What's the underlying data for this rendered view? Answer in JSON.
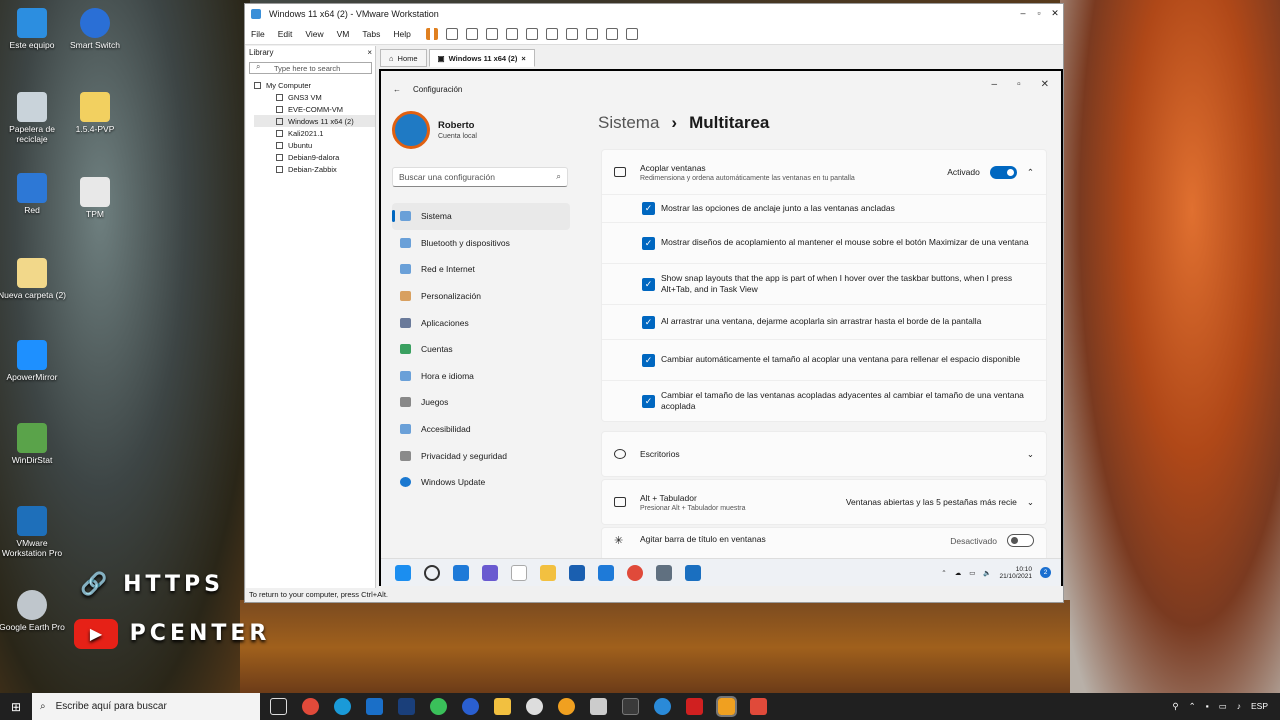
{
  "desktop": {
    "icons": [
      {
        "label": "Este equipo"
      },
      {
        "label": "Smart Switch"
      },
      {
        "label": "Papelera de reciclaje"
      },
      {
        "label": "1.5.4-PVP"
      },
      {
        "label": "Red"
      },
      {
        "label": "TPM"
      },
      {
        "label": "Nueva carpeta (2)"
      },
      {
        "label": "ApowerMirror"
      },
      {
        "label": "WinDirStat"
      },
      {
        "label": "VMware Workstation Pro"
      },
      {
        "label": "Google Earth Pro"
      }
    ],
    "overlay_line1": "HTTPS",
    "overlay_line2": "PCENTER"
  },
  "vmware": {
    "title": "Windows 11 x64 (2) - VMware Workstation",
    "menu": [
      "File",
      "Edit",
      "View",
      "VM",
      "Tabs",
      "Help"
    ],
    "library": {
      "header": "Library",
      "close": "×",
      "search_placeholder": "Type here to search",
      "root": "My Computer",
      "vms": [
        "GNS3 VM",
        "EVE-COMM-VM",
        "Windows 11 x64 (2)",
        "Kali2021.1",
        "Ubuntu",
        "Debian9-dalora",
        "Debian-Zabbix"
      ]
    },
    "tabs": [
      {
        "label": "Home"
      },
      {
        "label": "Windows 11 x64 (2)"
      }
    ],
    "status": "To return to your computer, press Ctrl+Alt."
  },
  "settings": {
    "app_title": "Configuración",
    "user": {
      "name": "Roberto",
      "account": "Cuenta local"
    },
    "search_placeholder": "Buscar una configuración",
    "nav": [
      "Sistema",
      "Bluetooth y dispositivos",
      "Red e Internet",
      "Personalización",
      "Aplicaciones",
      "Cuentas",
      "Hora e idioma",
      "Juegos",
      "Accesibilidad",
      "Privacidad y seguridad",
      "Windows Update"
    ],
    "breadcrumb": {
      "parent": "Sistema",
      "sep": "›",
      "current": "Multitarea"
    },
    "snap": {
      "title": "Acoplar ventanas",
      "subtitle": "Redimensiona y ordena automáticamente las ventanas en tu pantalla",
      "state": "Activado",
      "options": [
        "Mostrar las opciones de anclaje junto a las ventanas ancladas",
        "Mostrar diseños de acoplamiento al mantener el mouse sobre el botón Maximizar de una ventana",
        "Show snap layouts that the app is part of when I hover over the taskbar buttons, when I press Alt+Tab, and in Task View",
        "Al arrastrar una ventana, dejarme acoplarla sin arrastrar hasta el borde de la pantalla",
        "Cambiar automáticamente el tamaño al acoplar una ventana para rellenar el espacio disponible",
        "Cambiar el tamaño de las ventanas acopladas adyacentes al cambiar el tamaño de una ventana acoplada"
      ]
    },
    "desktops": {
      "title": "Escritorios"
    },
    "alttab": {
      "title": "Alt + Tabulador",
      "subtitle": "Presionar Alt + Tabulador muestra",
      "value": "Ventanas abiertas y las 5 pestañas más recie"
    },
    "shake": {
      "title": "Agitar barra de título en ventanas",
      "state": "Desactivado"
    }
  },
  "vm_taskbar": {
    "time": "10:10",
    "date": "21/10/2021",
    "badge": "2"
  },
  "host_taskbar": {
    "search_placeholder": "Escribe aquí para buscar",
    "lang": "ESP"
  }
}
